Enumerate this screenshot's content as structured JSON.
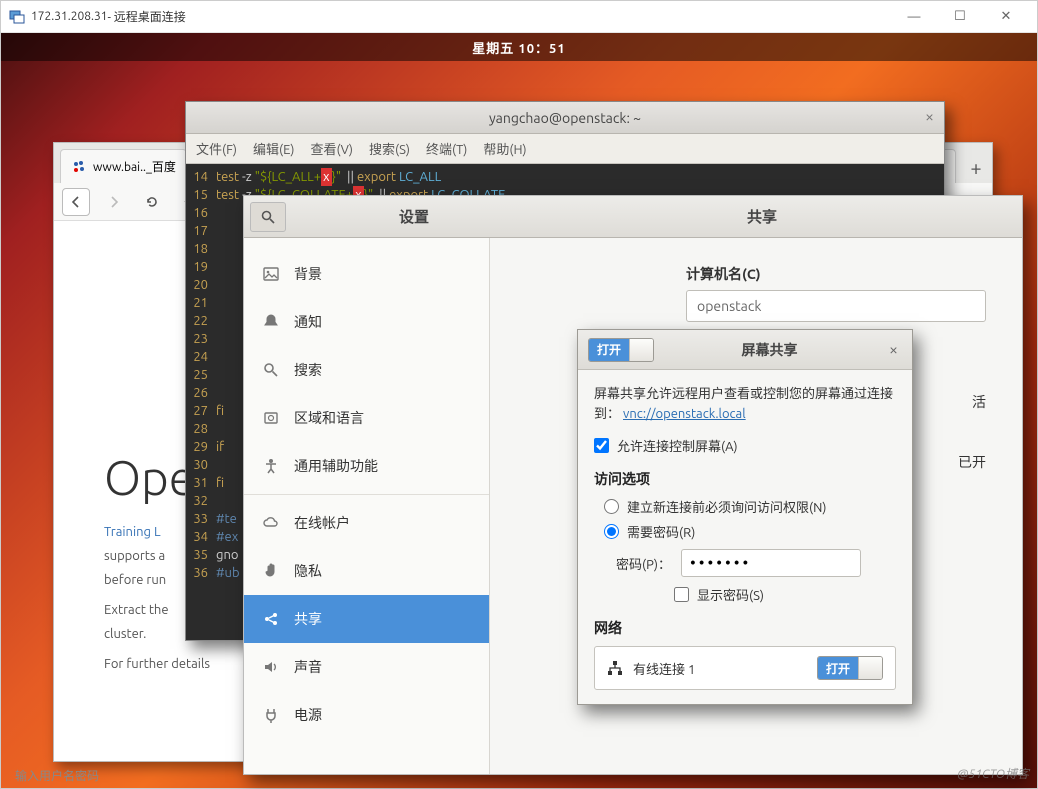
{
  "rdp": {
    "ip": "172.31.208.31",
    "title_suffix": " - 远程桌面连接",
    "min": "—",
    "max": "☐",
    "close": "✕"
  },
  "topbar": {
    "clock": "星期五 10：51"
  },
  "browser": {
    "tab_label": "www.bai.._百度",
    "plus": "+",
    "h1": "Ope",
    "p1": "Training L",
    "p1b": "supports a",
    "p1c": "before run",
    "p2": "Extract the",
    "p2b": "cluster.",
    "p3": "For further details"
  },
  "terminal": {
    "title": "yangchao@openstack: ~",
    "menu": [
      "文件(F)",
      "编辑(E)",
      "查看(V)",
      "搜索(S)",
      "终端(T)",
      "帮助(H)"
    ],
    "lines": [
      {
        "n": "14",
        "pre": "        ",
        "kw": "test",
        "rest1": " -z ",
        "str": "\"${LC_ALL+",
        "bad": "x",
        "str2": "}\"",
        "rest2": "  || ",
        "kw2": "export",
        "env": " LC_ALL"
      },
      {
        "n": "15",
        "pre": "        ",
        "kw": "test",
        "rest1": " -z ",
        "str": "\"${LC_COLLATE+",
        "bad": "x",
        "str2": "}\"",
        "rest2": "  || ",
        "kw2": "export",
        "env": " LC_COLLATE"
      },
      {
        "n": "16",
        "blank": true
      },
      {
        "n": "17",
        "blank": true
      },
      {
        "n": "18",
        "blank": true
      },
      {
        "n": "19",
        "blank": true
      },
      {
        "n": "20",
        "blank": true
      },
      {
        "n": "21",
        "blank": true
      },
      {
        "n": "22",
        "blank": true
      },
      {
        "n": "23",
        "blank": true
      },
      {
        "n": "24",
        "blank": true
      },
      {
        "n": "25",
        "blank": true
      },
      {
        "n": "26",
        "blank": true
      },
      {
        "n": "27",
        "plain": "fi"
      },
      {
        "n": "28",
        "blank": true
      },
      {
        "n": "29",
        "plain": "if"
      },
      {
        "n": "30",
        "blank": true
      },
      {
        "n": "31",
        "plain": "fi"
      },
      {
        "n": "32",
        "blank": true
      },
      {
        "n": "33",
        "cmt": "#te"
      },
      {
        "n": "34",
        "cmt": "#ex"
      },
      {
        "n": "35",
        "plain2": "gno"
      },
      {
        "n": "36",
        "cmt": "#ub"
      }
    ]
  },
  "settings": {
    "search_icon": "search",
    "title_left": "设置",
    "title_right": "共享",
    "sidebar": [
      {
        "icon": "picture",
        "label": "背景",
        "sel": false
      },
      {
        "icon": "bell",
        "label": "通知",
        "sel": false
      },
      {
        "icon": "search",
        "label": "搜索",
        "sel": false
      },
      {
        "icon": "globe",
        "label": "区域和语言",
        "sel": false
      },
      {
        "icon": "accessibility",
        "label": "通用辅助功能",
        "sel": false
      },
      {
        "sep": true
      },
      {
        "icon": "cloud",
        "label": "在线帐户",
        "sel": false
      },
      {
        "icon": "hand",
        "label": "隐私",
        "sel": false
      },
      {
        "icon": "share",
        "label": "共享",
        "sel": true
      },
      {
        "icon": "speaker",
        "label": "声音",
        "sel": false
      },
      {
        "icon": "plug",
        "label": "电源",
        "sel": false
      }
    ],
    "main": {
      "hostname_label": "计算机名(C)",
      "hostname_value": "openstack",
      "row_active": "活",
      "row_enabled": "已开"
    }
  },
  "dialog": {
    "switch_on": "打开",
    "title": "屏幕共享",
    "close": "×",
    "desc_pre": "屏幕共享允许远程用户查看或控制您的屏幕通过连接到：",
    "vnc_link": "vnc://openstack.local",
    "check_allow_control": "允许连接控制屏幕(A)",
    "section_access": "访问选项",
    "radio_ask": "建立新连接前必须询问访问权限(N)",
    "radio_pw": "需要密码(R)",
    "pw_label": "密码(P)：",
    "pw_value": "●●●●●●●",
    "check_show_pw": "显示密码(S)",
    "section_net": "网络",
    "net_item": "有线连接 1",
    "net_switch": "打开"
  },
  "watermark": "@51CTO博客",
  "footer_note": "输入用户名密码"
}
